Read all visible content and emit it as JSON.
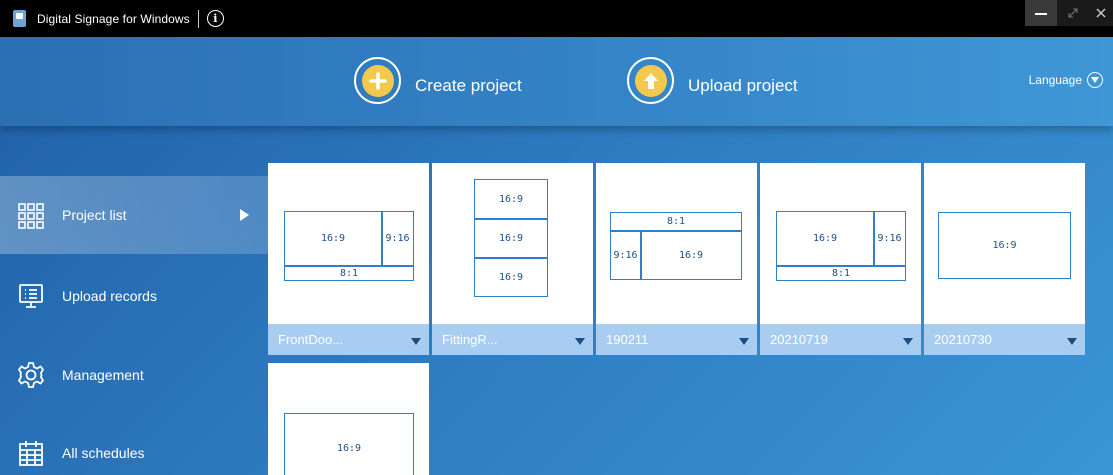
{
  "window": {
    "title": "Digital Signage for Windows",
    "info_icon": "i"
  },
  "header": {
    "create_label": "Create project",
    "upload_label": "Upload project",
    "language_label": "Language"
  },
  "sidebar": {
    "items": [
      {
        "label": "Project list",
        "icon": "grid-icon",
        "active": true
      },
      {
        "label": "Upload records",
        "icon": "monitor-icon"
      },
      {
        "label": "Management",
        "icon": "gear-icon"
      },
      {
        "label": "All schedules",
        "icon": "calendar-icon"
      }
    ]
  },
  "projects": [
    {
      "name": "FrontDoo...",
      "zones": [
        "16:9",
        "9:16",
        "8:1"
      ]
    },
    {
      "name": "FittingR...",
      "zones": [
        "16:9",
        "16:9",
        "16:9"
      ]
    },
    {
      "name": "190211",
      "zones": [
        "8:1",
        "9:16",
        "16:9"
      ]
    },
    {
      "name": "20210719",
      "zones": [
        "16:9",
        "9:16",
        "8:1"
      ]
    },
    {
      "name": "20210730",
      "zones": [
        "16:9"
      ]
    },
    {
      "name": "",
      "zones": [
        "16:9"
      ]
    }
  ],
  "colors": {
    "accent": "#f2c94c",
    "header": "#3382c5",
    "card_footer": "#a9cdf0",
    "layout_stroke": "#2f80c9"
  }
}
